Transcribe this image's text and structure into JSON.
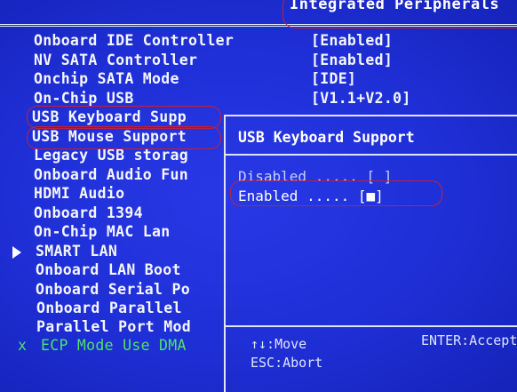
{
  "header": {
    "title": "Integrated Peripherals"
  },
  "menu": [
    {
      "label": "Onboard IDE Controller",
      "value": "[Enabled]"
    },
    {
      "label": "NV SATA Controller",
      "value": "[Enabled]"
    },
    {
      "label": "Onchip SATA Mode",
      "value": "[IDE]"
    },
    {
      "label": "On-Chip USB",
      "value": "[V1.1+V2.0]"
    },
    {
      "label": "USB Keyboard Supp"
    },
    {
      "label": "USB Mouse Support"
    },
    {
      "label": "Legacy USB storag"
    },
    {
      "label": "Onboard Audio Fun"
    },
    {
      "label": "HDMI Audio"
    },
    {
      "label": "Onboard 1394"
    },
    {
      "label": "On-Chip MAC Lan"
    },
    {
      "label": "SMART LAN"
    },
    {
      "label": "Onboard LAN Boot"
    },
    {
      "label": "Onboard Serial Po"
    },
    {
      "label": "Onboard Parallel"
    },
    {
      "label": "Parallel Port Mod"
    },
    {
      "label": "ECP Mode Use DMA",
      "mark": "x"
    }
  ],
  "popup": {
    "title": "USB Keyboard Support",
    "options": [
      {
        "label": "Disabled ..... [ ]",
        "selected": false
      },
      {
        "label": "Enabled  ..... [■]",
        "selected": true
      }
    ],
    "footer": {
      "move": "↑↓:Move",
      "abort": "ESC:Abort",
      "accept": "ENTER:Accept"
    }
  },
  "colors": {
    "background": "#1f2fd6",
    "text": "#f4f6ff",
    "disabled_text": "#4be36f",
    "annotation": "#c0223a"
  }
}
